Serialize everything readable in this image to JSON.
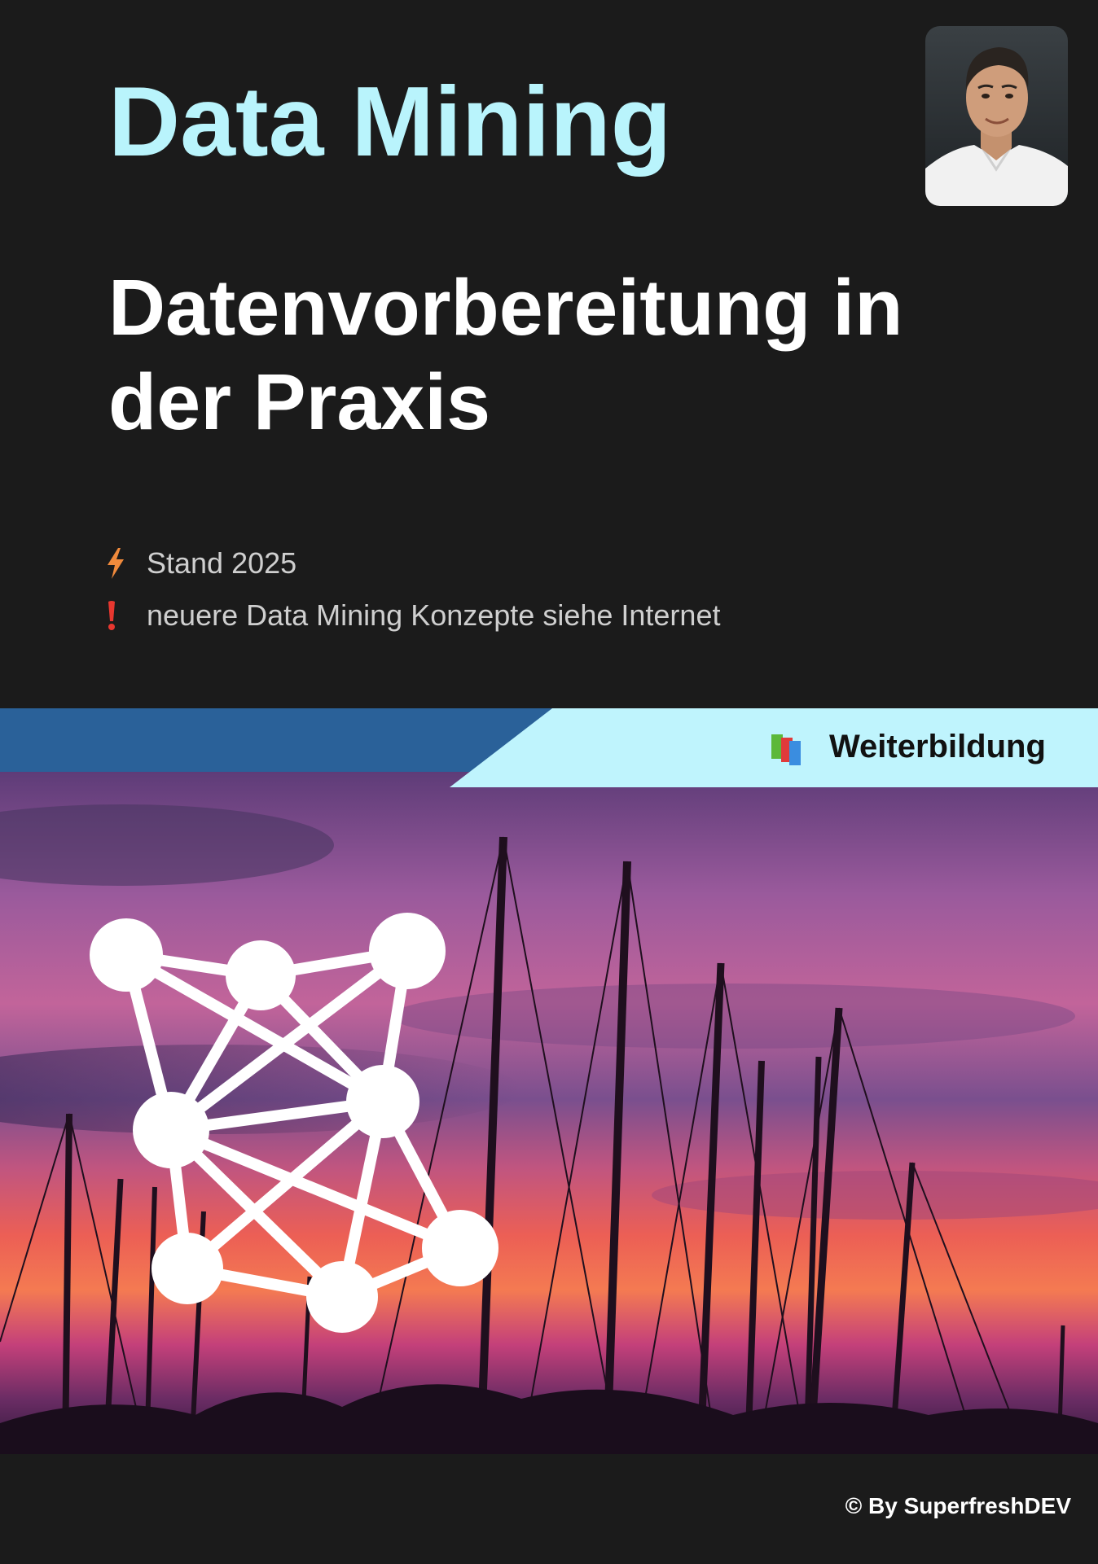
{
  "cover": {
    "title": "Data Mining",
    "subtitle": "Datenvorbereitung in der Praxis",
    "notes": [
      {
        "icon": "lightning-icon",
        "text": "Stand 2025",
        "color": "#f08a3c"
      },
      {
        "icon": "exclamation-icon",
        "text": "neuere Data Mining Konzepte siehe Internet",
        "color": "#e8372f"
      }
    ],
    "badge": {
      "icon": "books-icon",
      "label": "Weiterbildung"
    },
    "copyright": "© By SuperfreshDEV"
  },
  "colors": {
    "background": "#1b1b1b",
    "title": "#b9f4fc",
    "band_blue": "#2a6199",
    "band_light": "#bff4fd",
    "text_muted": "#cfcfcf"
  },
  "images": {
    "author_photo": "author-portrait",
    "hero": "sunset-sailboat-masts",
    "hero_overlay_icon": "network-graph-icon"
  }
}
